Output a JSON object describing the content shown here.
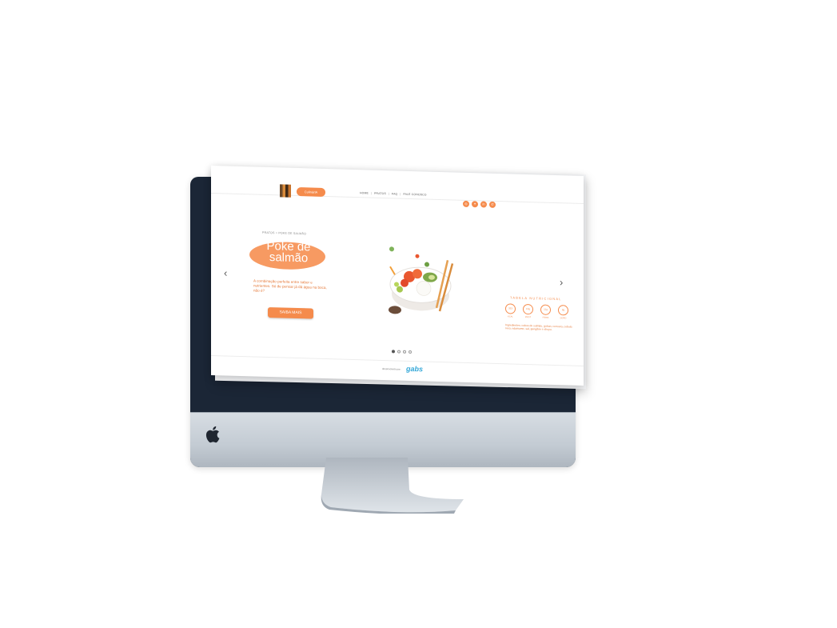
{
  "site": {
    "logo_text": "CulinárIA",
    "nav": [
      "HOME",
      "PRATOS",
      "FAQ",
      "FALE CONOSCO"
    ],
    "socials": [
      "instagram-icon",
      "twitter-icon",
      "linkedin-icon",
      "whatsapp-icon"
    ]
  },
  "hero": {
    "breadcrumb": "PRATOS > POKE DE SALMÃO",
    "title": "Poke de salmão",
    "description": "A combinação perfeita entre sabor e nutrientes. Só de pensar já dá água na boca, não é?",
    "cta_label": "SAIBA MAIS",
    "prev_arrow": "‹",
    "next_arrow": "›"
  },
  "nutrition": {
    "title": "TABELA NUTRICIONAL",
    "items": [
      {
        "value": "333",
        "label": "KCAL"
      },
      {
        "value": "13g",
        "label": "PROT"
      },
      {
        "value": "11g",
        "label": "FIBRA"
      },
      {
        "value": "8g",
        "label": "GORD"
      }
    ],
    "ingredients": "Ingredientes: cubos de salmão, gohan, cenoura, cebola roxa, edamame, sal, gengibre e shoyu."
  },
  "carousel": {
    "slides": 4,
    "active_index": 0
  },
  "footer": {
    "text": "desenvolvido por:",
    "brand": "gabs"
  },
  "colors": {
    "accent": "#f58b4c",
    "frame": "#1b2636",
    "stand": "#c3cbd3"
  }
}
